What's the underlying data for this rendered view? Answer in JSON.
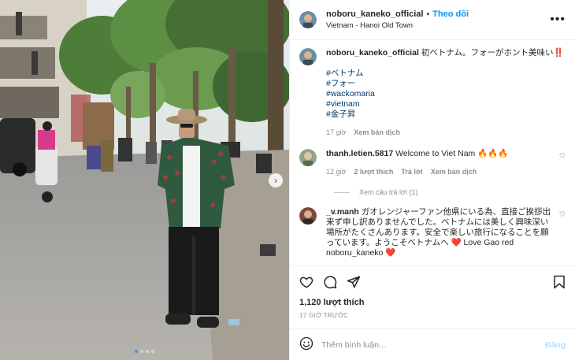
{
  "post": {
    "author": "noboru_kaneko_official",
    "follow_label": "Theo dõi",
    "location": "Vietnam - Hanoi Old Town",
    "caption": "初ベトナム。フォーがホント美味い‼️",
    "hashtags": [
      "#ベトナム",
      "#フォー",
      "#wackomaria",
      "#vietnam",
      "#金子昇"
    ],
    "caption_time": "17 giờ",
    "translate_label": "Xem bản dịch",
    "likes": "1,120 lượt thích",
    "posted_ago": "17 GIỜ TRƯỚC",
    "photo_slide": {
      "current": 1,
      "total": 4
    }
  },
  "comments": [
    {
      "user": "thanh.letien.5817",
      "text": "Welcome to Viet Nam 🔥🔥🔥",
      "time": "12 giờ",
      "likes": "2 lượt thích",
      "reply_label": "Trả lời",
      "translate_label": "Xem bản dịch",
      "view_replies": "Xem câu trả lời (1)"
    },
    {
      "user": "_v.manh",
      "text": "ガオレンジャーファン他県にいる為、直接ご挨拶出来ず申し訳ありませんでした。ベトナムには美しく興味深い場所がたくさんあります。安全で楽しい旅行になることを願っています。ようこそベトナムへ ❤️ Love Gao red noboru_kaneko ❤️"
    }
  ],
  "add_comment": {
    "placeholder": "Thêm bình luận...",
    "post_label": "Đăng"
  },
  "icons": {
    "more": "more-icon",
    "like": "heart-icon",
    "comment": "comment-icon",
    "share": "share-icon",
    "save": "bookmark-icon",
    "emoji": "emoji-icon"
  },
  "colors": {
    "accent": "#0095f6",
    "hashtag": "#00376b",
    "muted": "#8e8e8e"
  }
}
